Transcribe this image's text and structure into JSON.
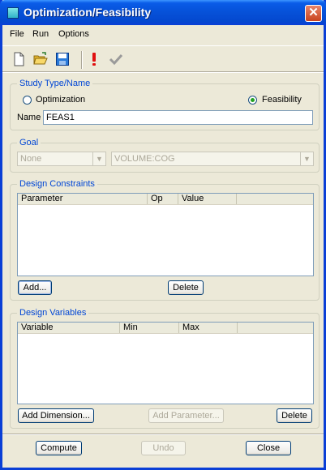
{
  "window": {
    "title": "Optimization/Feasibility",
    "close_glyph": "✕"
  },
  "menu": [
    "File",
    "Run",
    "Options"
  ],
  "toolbar": {
    "icons": [
      "new-file-icon",
      "open-folder-icon",
      "save-icon",
      "run-exclamation-icon",
      "check-icon"
    ],
    "colors": {
      "exclamation": "#e01010",
      "check": "#9a9a9a"
    }
  },
  "study": {
    "legend": "Study Type/Name",
    "option_optimization": "Optimization",
    "option_feasibility": "Feasibility",
    "selected": "Feasibility",
    "name_label": "Name",
    "name_value": "FEAS1"
  },
  "goal": {
    "legend": "Goal",
    "type_value": "None",
    "measure_value": "VOLUME:COG"
  },
  "constraints": {
    "legend": "Design Constraints",
    "columns": [
      "Parameter",
      "Op",
      "Value"
    ],
    "rows": [],
    "add_label": "Add...",
    "delete_label": "Delete"
  },
  "variables": {
    "legend": "Design Variables",
    "columns": [
      "Variable",
      "Min",
      "Max"
    ],
    "rows": [],
    "add_dimension_label": "Add Dimension...",
    "add_parameter_label": "Add Parameter...",
    "delete_label": "Delete"
  },
  "footer": {
    "compute_label": "Compute",
    "undo_label": "Undo",
    "close_label": "Close"
  },
  "colors": {
    "title_bar": "#0652d9",
    "group_legend": "#0046d5",
    "face": "#ece9d8"
  }
}
